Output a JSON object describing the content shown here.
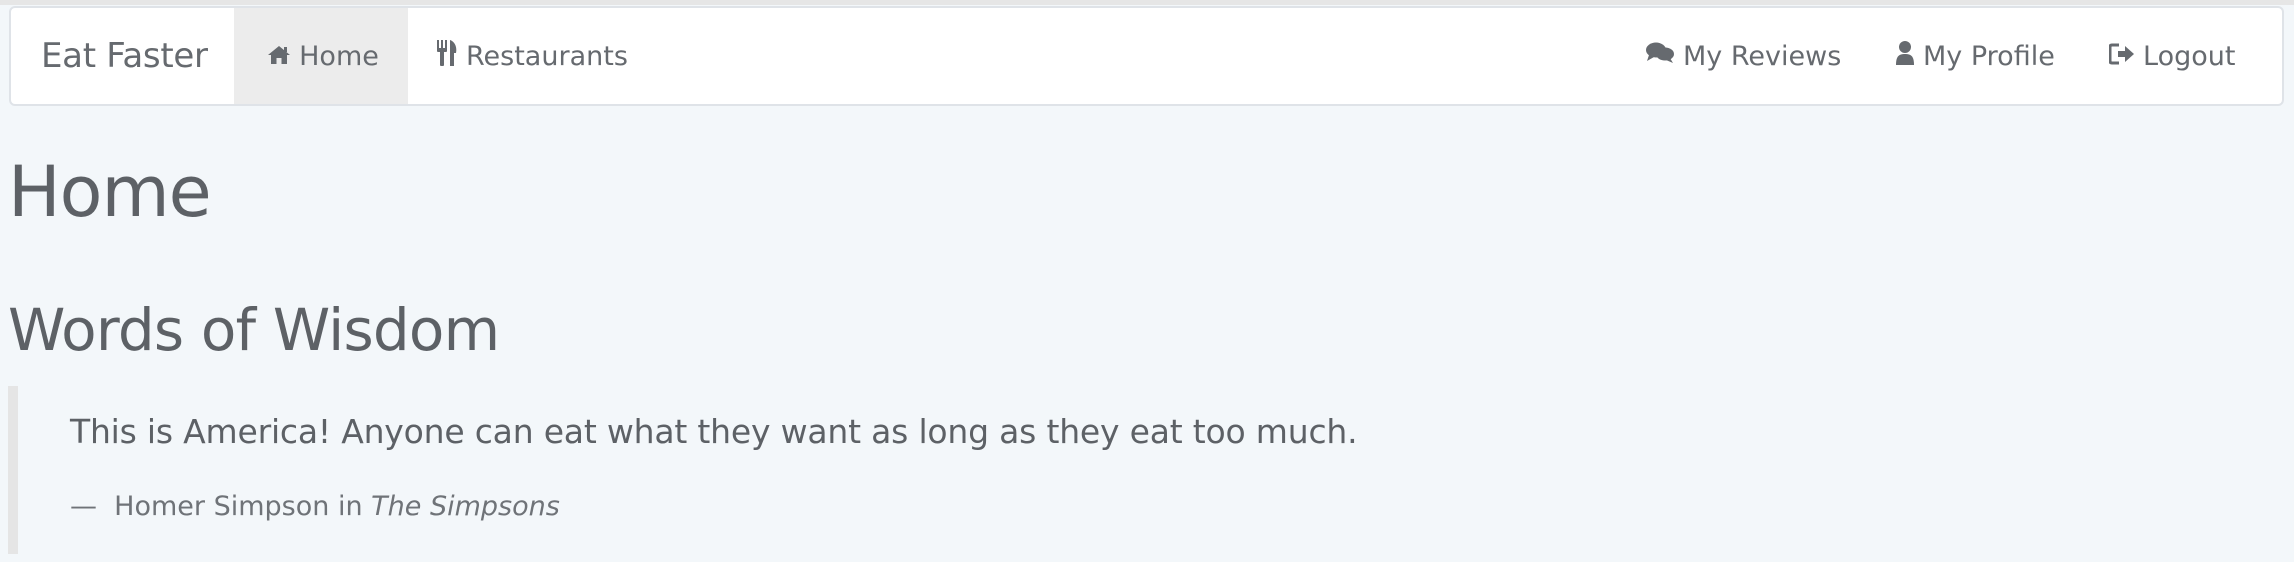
{
  "navbar": {
    "brand": "Eat Faster",
    "left_items": [
      {
        "label": "Home",
        "icon": "home-icon",
        "active": true
      },
      {
        "label": "Restaurants",
        "icon": "utensils-icon",
        "active": false
      }
    ],
    "right_items": [
      {
        "label": "My Reviews",
        "icon": "comments-icon"
      },
      {
        "label": "My Profile",
        "icon": "user-icon"
      },
      {
        "label": "Logout",
        "icon": "logout-icon"
      }
    ]
  },
  "page": {
    "title": "Home",
    "section_title": "Words of Wisdom"
  },
  "quote": {
    "text": "This is America! Anyone can eat what they want as long as they eat too much.",
    "dash": "—",
    "author_prefix": "Homer Simpson in",
    "source": "The Simpsons"
  },
  "colors": {
    "background": "#f3f7fa",
    "navbar_bg": "#ffffff",
    "active_tab_bg": "#ececec",
    "text": "#5b6066",
    "quote_border": "#e5e5e5"
  }
}
